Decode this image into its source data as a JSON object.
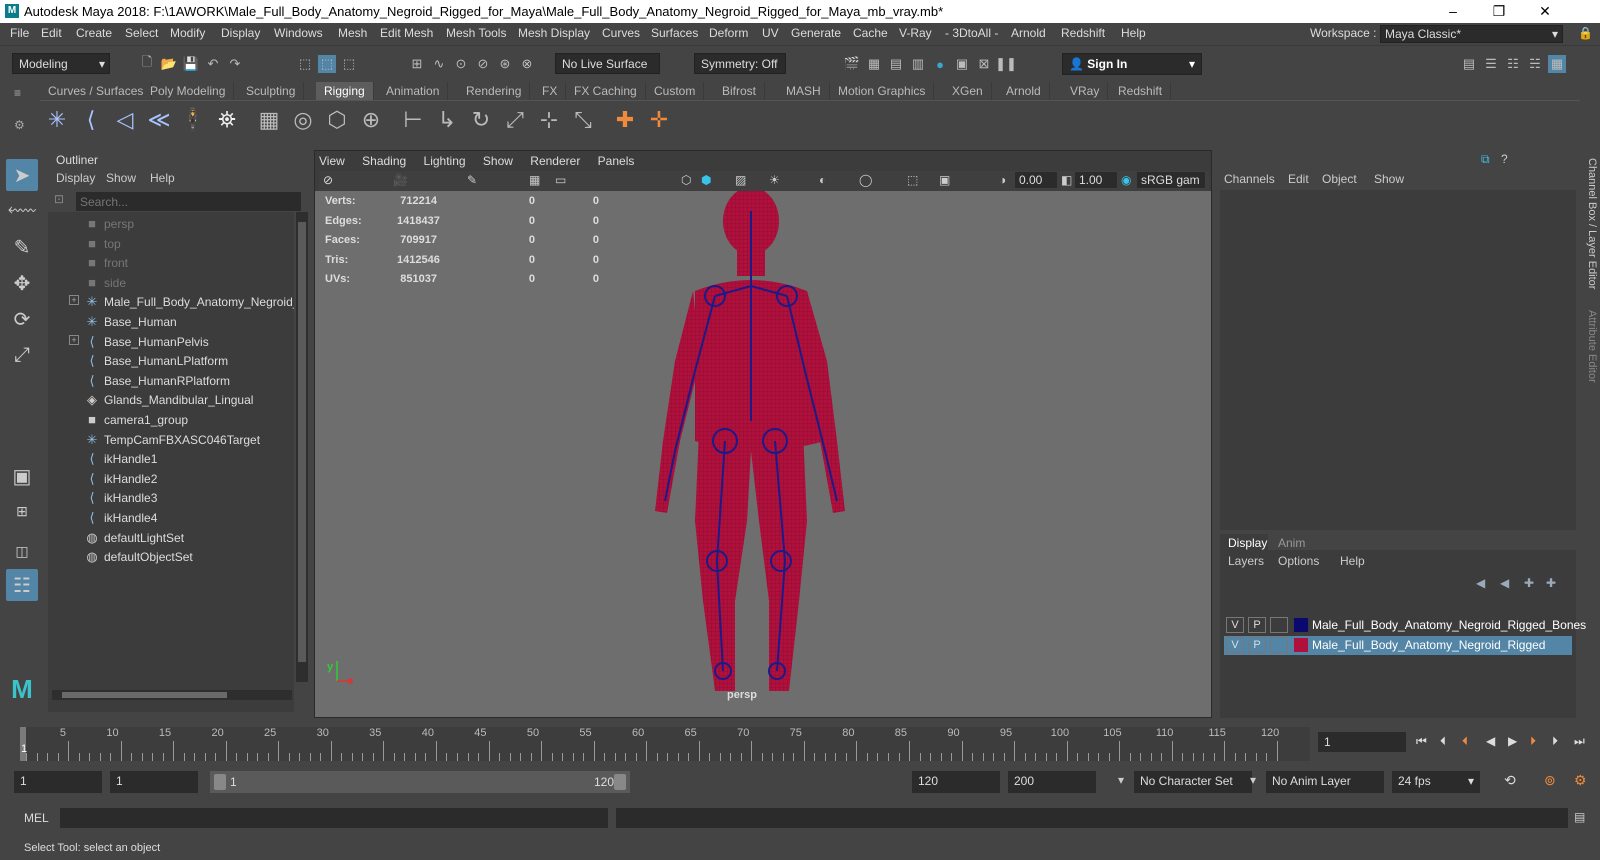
{
  "title_bar": {
    "app_title": "Autodesk Maya 2018: F:\\1AWORK\\Male_Full_Body_Anatomy_Negroid_Rigged_for_Maya\\Male_Full_Body_Anatomy_Negroid_Rigged_for_Maya_mb_vray.mb*",
    "logo": "M",
    "minimize": "–",
    "maximize": "❐",
    "close": "✕"
  },
  "menubar": {
    "items": [
      "File",
      "Edit",
      "Create",
      "Select",
      "Modify",
      "Display",
      "Windows",
      "Mesh",
      "Edit Mesh",
      "Mesh Tools",
      "Mesh Display",
      "Curves",
      "Surfaces",
      "Deform",
      "UV",
      "Generate",
      "Cache",
      "V-Ray",
      "- 3DtoAll -",
      "Arnold",
      "Redshift",
      "Help"
    ],
    "workspace_label": "Workspace :",
    "workspace_value": "Maya Classic*"
  },
  "statusline": {
    "mode": "Modeling",
    "live_surface": "No Live Surface",
    "symmetry": "Symmetry: Off",
    "sign_in": "Sign In"
  },
  "shelf_tabs": {
    "items": [
      "Curves / Surfaces",
      "Poly Modeling",
      "Sculpting",
      "Rigging",
      "Animation",
      "Rendering",
      "FX",
      "FX Caching",
      "Custom",
      "Bifrost",
      "MASH",
      "Motion Graphics",
      "XGen",
      "Arnold",
      "VRay",
      "Redshift"
    ],
    "active": "Rigging"
  },
  "outliner": {
    "title": "Outliner",
    "menu": [
      "Display",
      "Show",
      "Help"
    ],
    "search_placeholder": "Search...",
    "items": [
      {
        "label": "persp",
        "icon": "camera-icon",
        "dim": true,
        "expand": false
      },
      {
        "label": "top",
        "icon": "camera-icon",
        "dim": true,
        "expand": false
      },
      {
        "label": "front",
        "icon": "camera-icon",
        "dim": true,
        "expand": false
      },
      {
        "label": "side",
        "icon": "camera-icon",
        "dim": true,
        "expand": false
      },
      {
        "label": "Male_Full_Body_Anatomy_Negroid_Ri",
        "icon": "joint-icon",
        "dim": false,
        "expand": true
      },
      {
        "label": "Base_Human",
        "icon": "joint-icon",
        "dim": false,
        "expand": false
      },
      {
        "label": "Base_HumanPelvis",
        "icon": "ik-icon",
        "dim": false,
        "expand": true
      },
      {
        "label": "Base_HumanLPlatform",
        "icon": "ik-icon",
        "dim": false,
        "expand": false
      },
      {
        "label": "Base_HumanRPlatform",
        "icon": "ik-icon",
        "dim": false,
        "expand": false
      },
      {
        "label": "Glands_Mandibular_Lingual",
        "icon": "mesh-icon",
        "dim": false,
        "expand": false
      },
      {
        "label": "camera1_group",
        "icon": "camera-icon",
        "dim": false,
        "expand": false
      },
      {
        "label": "TempCamFBXASC046Target",
        "icon": "joint-icon",
        "dim": false,
        "expand": false
      },
      {
        "label": "ikHandle1",
        "icon": "ik-icon",
        "dim": false,
        "expand": false
      },
      {
        "label": "ikHandle2",
        "icon": "ik-icon",
        "dim": false,
        "expand": false
      },
      {
        "label": "ikHandle3",
        "icon": "ik-icon",
        "dim": false,
        "expand": false
      },
      {
        "label": "ikHandle4",
        "icon": "ik-icon",
        "dim": false,
        "expand": false
      },
      {
        "label": "defaultLightSet",
        "icon": "set-icon",
        "dim": false,
        "expand": false
      },
      {
        "label": "defaultObjectSet",
        "icon": "set-icon",
        "dim": false,
        "expand": false
      }
    ]
  },
  "viewport": {
    "menu": [
      "View",
      "Shading",
      "Lighting",
      "Show",
      "Renderer",
      "Panels"
    ],
    "exposure": "0.00",
    "gamma": "1.00",
    "color_space": "sRGB gam",
    "camera_label": "persp",
    "stats": [
      {
        "label": "Verts:",
        "v1": "712214",
        "v2": "0",
        "v3": "0"
      },
      {
        "label": "Edges:",
        "v1": "1418437",
        "v2": "0",
        "v3": "0"
      },
      {
        "label": "Faces:",
        "v1": "709917",
        "v2": "0",
        "v3": "0"
      },
      {
        "label": "Tris:",
        "v1": "1412546",
        "v2": "0",
        "v3": "0"
      },
      {
        "label": "UVs:",
        "v1": "851037",
        "v2": "0",
        "v3": "0"
      }
    ],
    "axis_y": "y",
    "axis_x": "x"
  },
  "channel_box": {
    "menu": [
      "Channels",
      "Edit",
      "Object",
      "Show"
    ]
  },
  "layer_editor": {
    "tabs": [
      "Display",
      "Anim"
    ],
    "menu": [
      "Layers",
      "Options",
      "Help"
    ],
    "layers": [
      {
        "v": "V",
        "p": "P",
        "name": "Male_Full_Body_Anatomy_Negroid_Rigged_Bones",
        "color": "#0a0a6e",
        "selected": false
      },
      {
        "v": "V",
        "p": "P",
        "name": "Male_Full_Body_Anatomy_Negroid_Rigged",
        "color": "#b0103c",
        "selected": true
      }
    ]
  },
  "side_tabs": {
    "channel_box": "Channel Box / Layer Editor",
    "attribute_editor": "Attribute Editor"
  },
  "timeline": {
    "ticks": [
      "5",
      "10",
      "15",
      "20",
      "25",
      "30",
      "35",
      "40",
      "45",
      "50",
      "55",
      "60",
      "65",
      "70",
      "75",
      "80",
      "85",
      "90",
      "95",
      "100",
      "105",
      "110",
      "115",
      "120"
    ],
    "current_frame": "1",
    "frame_field": "1"
  },
  "range": {
    "start": "1",
    "playback_start": "1",
    "slider_start": "1",
    "slider_end": "120",
    "playback_end": "120",
    "end": "200",
    "character_set": "No Character Set",
    "anim_layer": "No Anim Layer",
    "fps": "24 fps"
  },
  "command_line": {
    "label": "MEL"
  },
  "help_line": {
    "text": "Select Tool: select an object"
  }
}
